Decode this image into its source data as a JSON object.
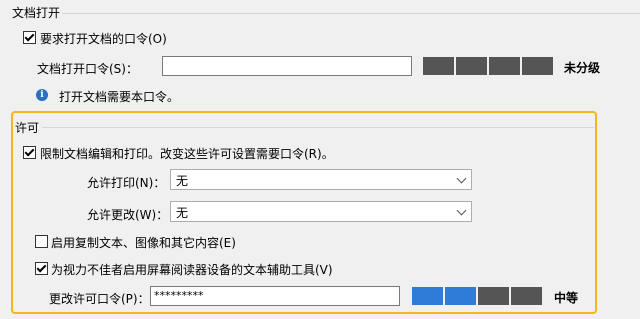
{
  "open_section": {
    "title": "文档打开",
    "require_checkbox": {
      "label": "要求打开文档的口令(O)",
      "checked": true
    },
    "password_label": "文档打开口令(S)：",
    "password_value": "",
    "strength_text": "未分级",
    "info_text": "打开文档需要本口令。"
  },
  "perm_section": {
    "title": "许可",
    "restrict_checkbox": {
      "label": "限制文档编辑和打印。改变这些许可设置需要口令(R)。",
      "checked": true
    },
    "print_label": "允许打印(N)：",
    "print_value": "无",
    "change_label": "允许更改(W)：",
    "change_value": "无",
    "copy_checkbox": {
      "label": "启用复制文本、图像和其它内容(E)",
      "checked": false
    },
    "reader_checkbox": {
      "label": "为视力不佳者启用屏幕阅读器设备的文本辅助工具(V)",
      "checked": true
    },
    "perm_password_label": "更改许可口令(P)：",
    "perm_password_value": "*********",
    "strength_text": "中等",
    "strength_level": 2
  },
  "colors": {
    "highlight": "#f5b51c",
    "meter_on": "#2e7cd6",
    "meter_off": "#555555"
  }
}
